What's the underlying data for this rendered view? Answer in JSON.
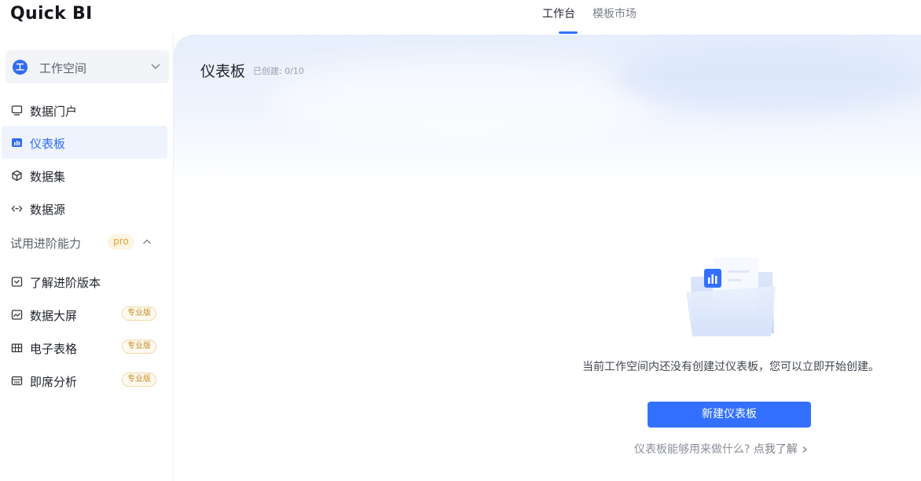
{
  "app": {
    "logo": "Quick BI"
  },
  "header": {
    "tabs": [
      {
        "label": "工作台",
        "active": true
      },
      {
        "label": "模板市场",
        "active": false
      }
    ]
  },
  "sidebar": {
    "workspace": {
      "icon_text": "工",
      "label": "工作空间"
    },
    "items": [
      {
        "label": "数据门户",
        "icon": "monitor-icon"
      },
      {
        "label": "仪表板",
        "icon": "bar-chart-icon",
        "active": true
      },
      {
        "label": "数据集",
        "icon": "cube-icon"
      },
      {
        "label": "数据源",
        "icon": "link-arrows-icon"
      }
    ],
    "section": {
      "title": "试用进阶能力",
      "badge": "pro"
    },
    "advanced_items": [
      {
        "label": "了解进阶版本",
        "icon": "check-square-icon"
      },
      {
        "label": "数据大屏",
        "icon": "screen-chart-icon",
        "tag": "专业版"
      },
      {
        "label": "电子表格",
        "icon": "table-icon",
        "tag": "专业版"
      },
      {
        "label": "即席分析",
        "icon": "query-icon",
        "tag": "专业版"
      }
    ]
  },
  "main": {
    "title": "仪表板",
    "created_count": "已创建: 0/10",
    "empty_text": "当前工作空间内还没有创建过仪表板，您可以立即开始创建。",
    "create_button": "新建仪表板",
    "help_question": "仪表板能够用来做什么?",
    "help_link": "点我了解"
  },
  "colors": {
    "accent": "#3370ff",
    "pro": "#e3a233"
  }
}
